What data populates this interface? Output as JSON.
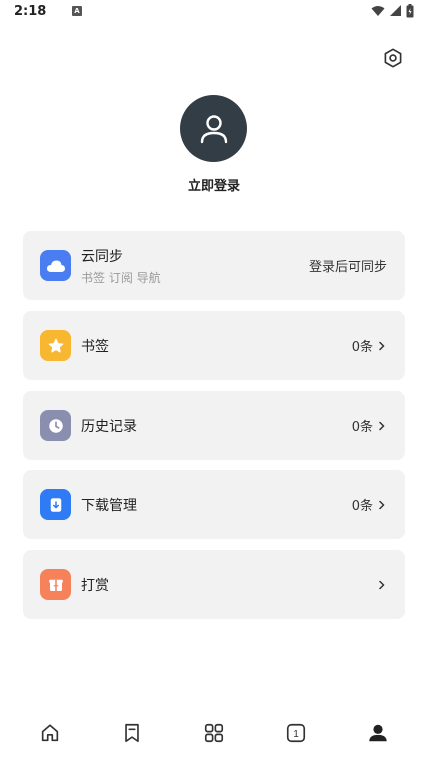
{
  "status_bar": {
    "time": "2:18",
    "notification_icon": "a-badge-icon",
    "icons": [
      "wifi-icon",
      "signal-icon",
      "battery-icon"
    ]
  },
  "header": {
    "settings_icon": "hexagon-settings-icon"
  },
  "profile": {
    "avatar_icon": "user-icon",
    "login_label": "立即登录"
  },
  "cards": {
    "sync": {
      "title": "云同步",
      "subtitle": "书签 订阅 导航",
      "right_text": "登录后可同步",
      "icon": "cloud-icon",
      "icon_color": "#4a7df2"
    },
    "bookmarks": {
      "title": "书签",
      "right_text": "0条",
      "icon": "star-icon",
      "icon_color": "#f7b731"
    },
    "history": {
      "title": "历史记录",
      "right_text": "0条",
      "icon": "clock-icon",
      "icon_color": "#8a8fb0"
    },
    "downloads": {
      "title": "下载管理",
      "right_text": "0条",
      "icon": "download-icon",
      "icon_color": "#2f7bf5"
    },
    "reward": {
      "title": "打赏",
      "right_text": "",
      "icon": "gift-icon",
      "icon_color": "#f7815a"
    }
  },
  "tab_bar": {
    "tabs": [
      {
        "name": "home",
        "icon": "home-icon"
      },
      {
        "name": "bookmark",
        "icon": "bookmark-icon"
      },
      {
        "name": "apps",
        "icon": "grid-icon"
      },
      {
        "name": "tabs",
        "icon": "tab-count-icon",
        "count": "1"
      },
      {
        "name": "profile",
        "icon": "user-filled-icon",
        "active": true
      }
    ]
  }
}
